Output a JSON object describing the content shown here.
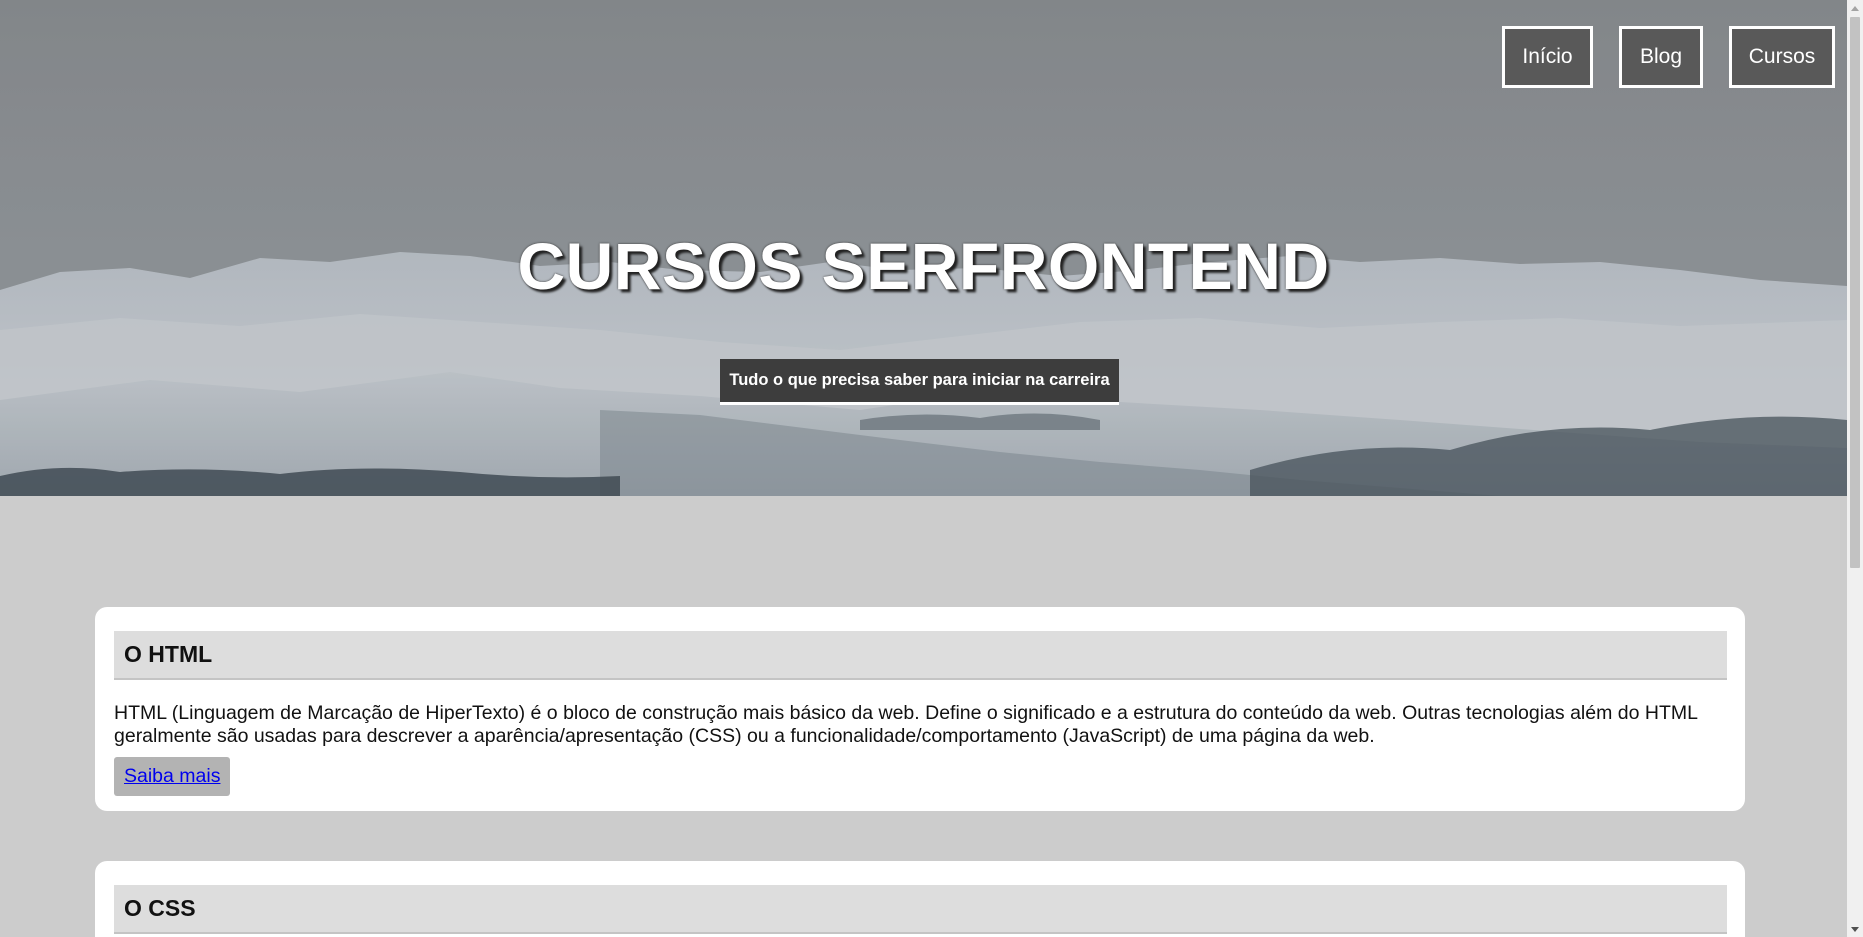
{
  "nav": {
    "items": [
      "Início",
      "Blog",
      "Cursos"
    ]
  },
  "hero": {
    "title": "CURSOS SERFRONTEND",
    "subtitle": "Tudo o que precisa saber para iniciar na carreira"
  },
  "cards": [
    {
      "heading": "O HTML",
      "text": "HTML (Linguagem de Marcação de HiperTexto) é o bloco de construção mais básico da web. Define o significado e a estrutura do conteúdo da web. Outras tecnologias além do HTML geralmente são usadas para descrever a aparência/apresentação (CSS) ou a funcionalidade/comportamento (JavaScript) de uma página da web.",
      "link": "Saiba mais"
    },
    {
      "heading": "O CSS"
    }
  ],
  "colors": {
    "page_bg": "#cccccc",
    "nav_button_bg": "#595959",
    "subtitle_bg": "#3d3d3d",
    "card_header_bg": "#dddddd",
    "link": "#0000ee"
  }
}
